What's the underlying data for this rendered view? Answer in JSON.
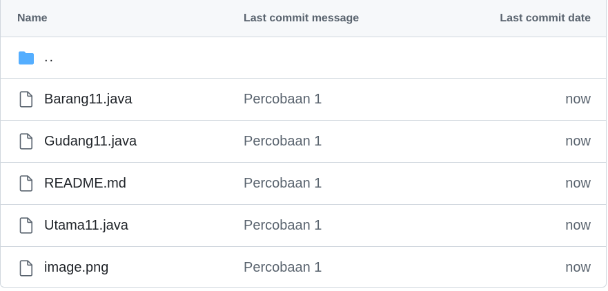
{
  "header": {
    "name": "Name",
    "message": "Last commit message",
    "date": "Last commit date"
  },
  "parent_dir": {
    "label": "..",
    "icon": "folder-icon",
    "icon_color": "#54aeff"
  },
  "files": [
    {
      "name": "Barang11.java",
      "message": "Percobaan 1",
      "date": "now",
      "icon": "file-icon"
    },
    {
      "name": "Gudang11.java",
      "message": "Percobaan 1",
      "date": "now",
      "icon": "file-icon"
    },
    {
      "name": "README.md",
      "message": "Percobaan 1",
      "date": "now",
      "icon": "file-icon"
    },
    {
      "name": "Utama11.java",
      "message": "Percobaan 1",
      "date": "now",
      "icon": "file-icon"
    },
    {
      "name": "image.png",
      "message": "Percobaan 1",
      "date": "now",
      "icon": "file-icon"
    }
  ],
  "colors": {
    "border": "#d0d7de",
    "header_bg": "#f6f8fa",
    "muted_text": "#59636e",
    "text": "#1f2328",
    "folder": "#54aeff"
  }
}
